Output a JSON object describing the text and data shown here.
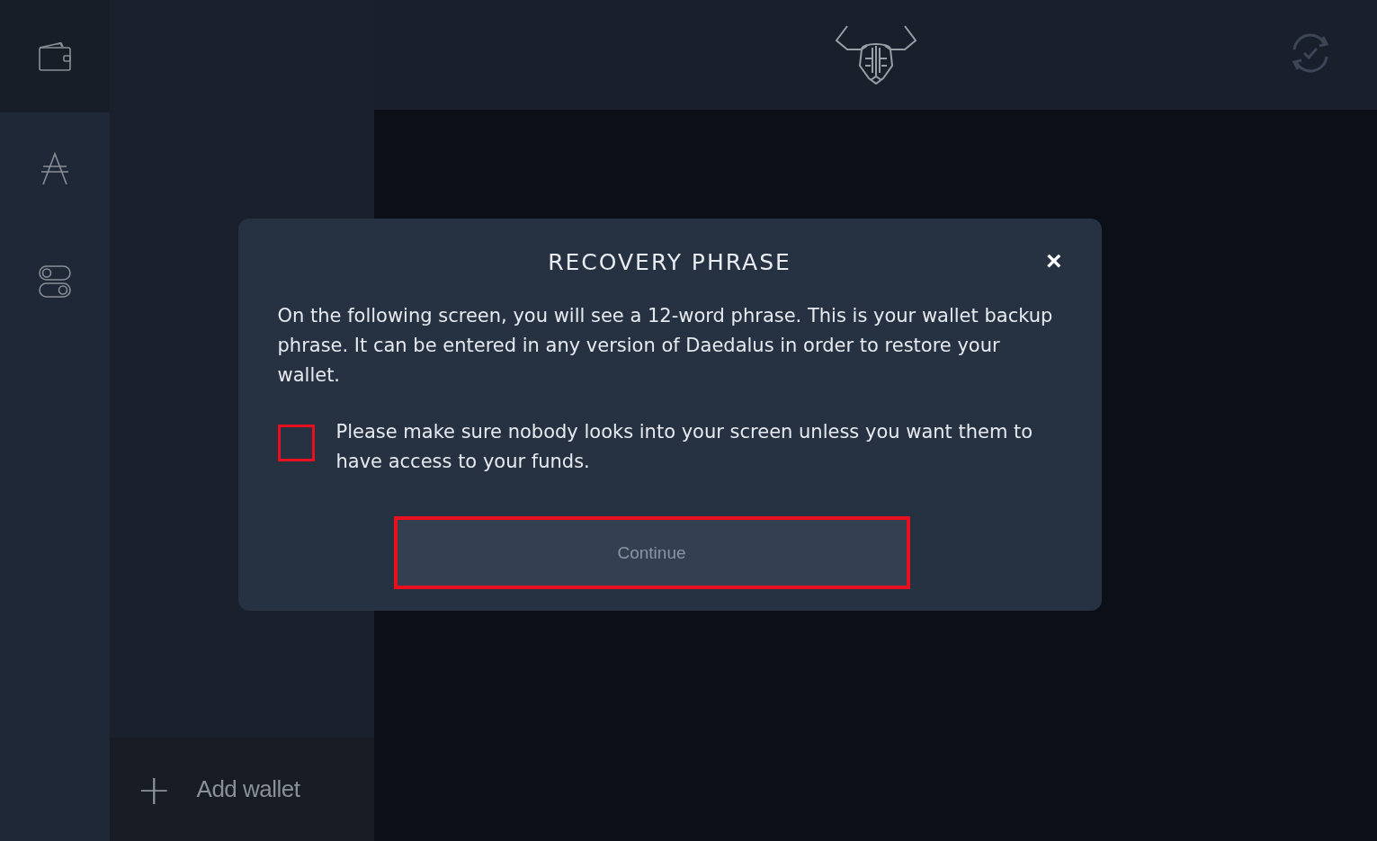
{
  "sidebar": {
    "items": [
      {
        "kind": "wallet",
        "selected": true
      },
      {
        "kind": "ada",
        "selected": false
      },
      {
        "kind": "settings",
        "selected": false
      }
    ]
  },
  "wallet_panel": {
    "add_wallet": {
      "icon": "+",
      "label": "Add wallet"
    }
  },
  "dialog": {
    "title": "RECOVERY PHRASE",
    "close": "×",
    "body": "On the following screen, you will see a 12-word phrase. This is your wallet backup phrase. It can be entered in any version of Daedalus in order to restore your wallet.",
    "checkbox": {
      "label": "Please make sure nobody looks into your screen unless you want them to have access to your funds.",
      "checked": false,
      "highlighted": true
    },
    "button": {
      "label": "Continue",
      "disabled": true,
      "highlighted": true
    }
  }
}
